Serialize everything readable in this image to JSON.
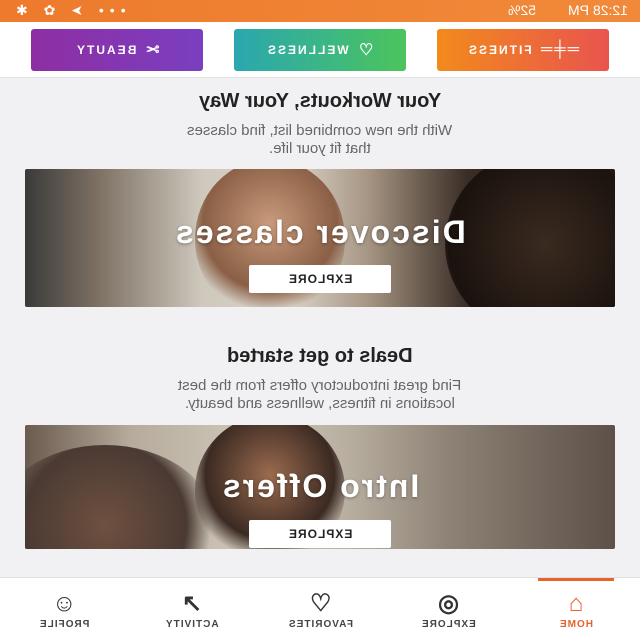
{
  "status_bar": {
    "time": "12:28 PM",
    "battery": "52%",
    "left_icons": "••• ➤ ✿ ✱"
  },
  "categories": [
    {
      "label": "BEAUTY",
      "icon": "scissors-icon",
      "glyph": "✂"
    },
    {
      "label": "WELLNESS",
      "icon": "heart-icon",
      "glyph": "♡"
    },
    {
      "label": "FITNESS",
      "icon": "dumbbell-icon",
      "glyph": "═╪═"
    }
  ],
  "workouts": {
    "title": "Your Workouts, Your Way",
    "subtitle_line1": "With the new combined list, find classes",
    "subtitle_line2": "that fit your life.",
    "banner_title": "Discover classes",
    "button": "EXPLORE"
  },
  "deals": {
    "title": "Deals to get started",
    "subtitle_line1": "Find great introductory offers from the best",
    "subtitle_line2": "locations in fitness, wellness and beauty.",
    "banner_title": "Intro Offers",
    "button": "EXPLORE"
  },
  "bottom_nav": [
    {
      "label": "PROFILE",
      "icon": "profile-icon",
      "glyph": "☺"
    },
    {
      "label": "ACTIVITY",
      "icon": "activity-icon",
      "glyph": "↗"
    },
    {
      "label": "FAVORITES",
      "icon": "heart-icon",
      "glyph": "♡"
    },
    {
      "label": "EXPLORE",
      "icon": "compass-icon",
      "glyph": "◎"
    },
    {
      "label": "HOME",
      "icon": "home-icon",
      "glyph": "⌂",
      "active": true
    }
  ],
  "colors": {
    "accent": "#e8622c",
    "beauty": "#8e2ea3",
    "wellness": "#3bb58a",
    "fitness": "#ee6e35"
  }
}
